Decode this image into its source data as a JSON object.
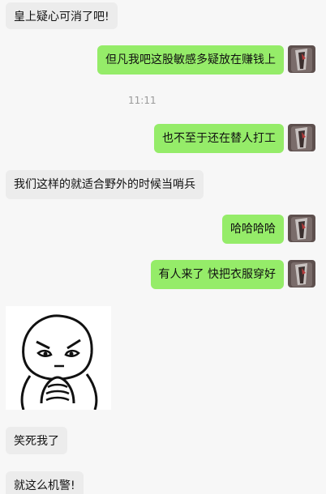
{
  "messages": [
    {
      "side": "left",
      "text": "皇上疑心可消了吧!"
    },
    {
      "side": "right",
      "text": "但凡我吧这股敏感多疑放在赚钱上"
    },
    {
      "time": "11:11"
    },
    {
      "side": "right",
      "text": "也不至于还在替人打工"
    },
    {
      "side": "left",
      "text": "我们这样的就适合野外的时候当哨兵"
    },
    {
      "side": "right",
      "text": "哈哈哈哈"
    },
    {
      "side": "right",
      "text": "有人来了 快把衣服穿好"
    },
    {
      "side": "left",
      "sticker": "thinking-face-sticker"
    },
    {
      "side": "left",
      "text": "笑死我了"
    },
    {
      "side": "left",
      "text": "就这么机警!"
    }
  ],
  "colors": {
    "background": "#f7f7f7",
    "left_bubble": "#ececec",
    "right_bubble": "#95ec69",
    "timestamp": "#9a9a9a"
  }
}
